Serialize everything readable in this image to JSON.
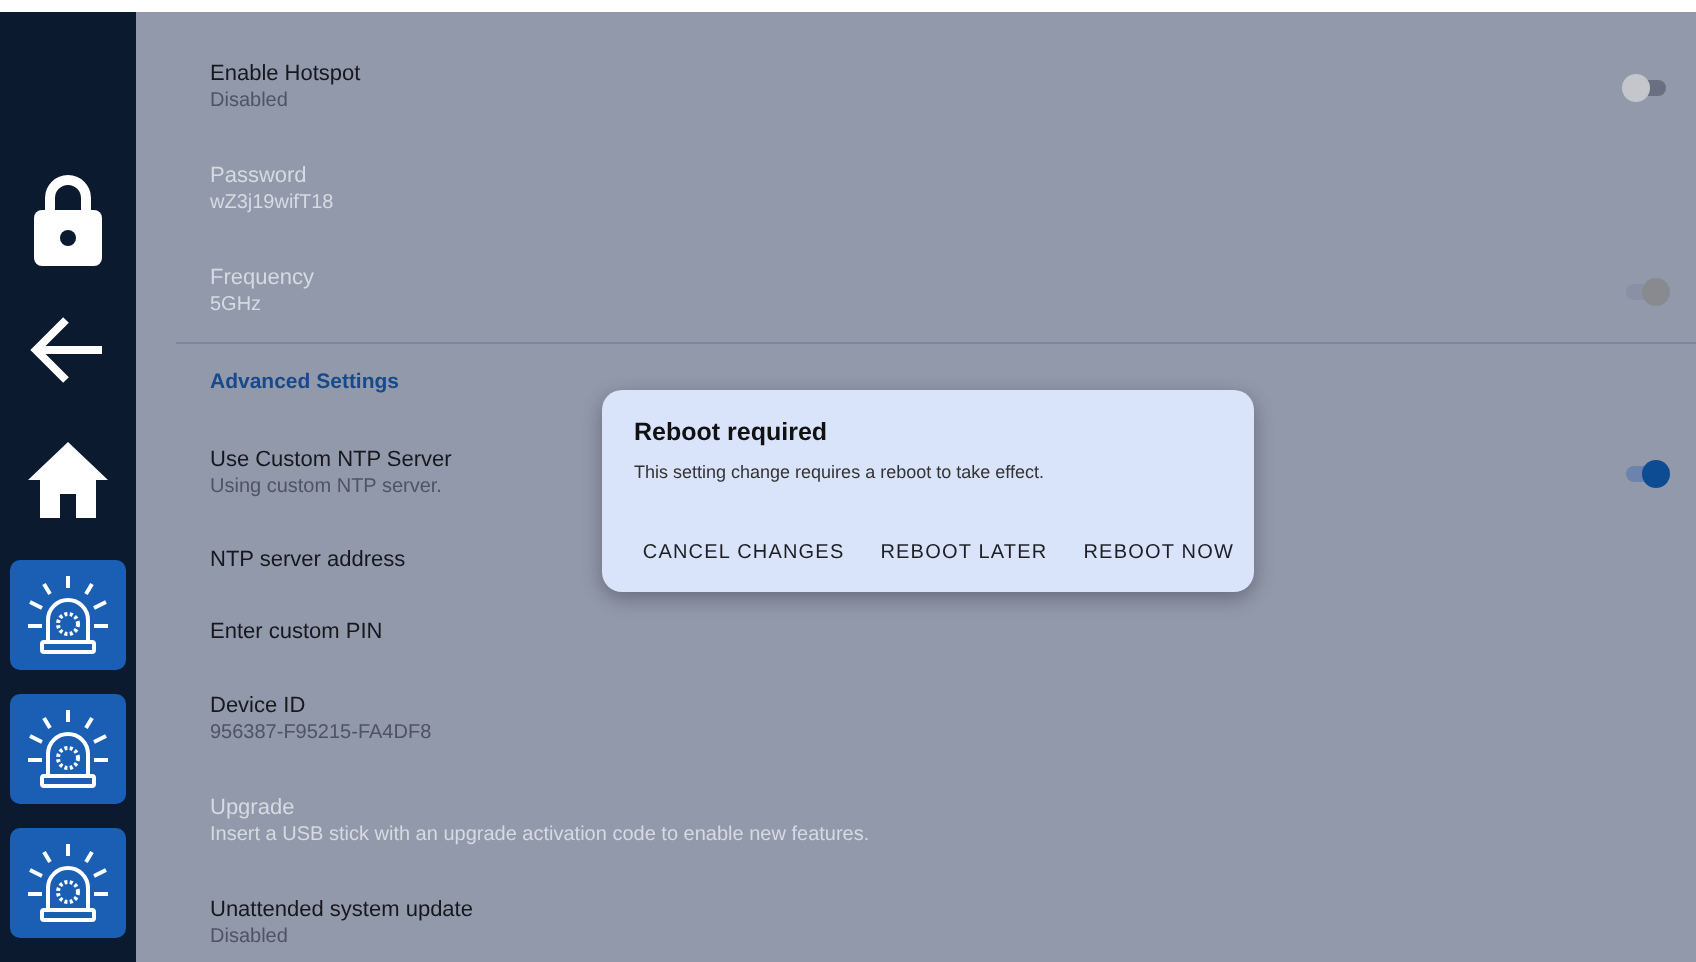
{
  "sidebar": {
    "buttons": [
      {
        "kind": "lock"
      },
      {
        "kind": "back"
      },
      {
        "kind": "home"
      },
      {
        "kind": "beacon"
      },
      {
        "kind": "beacon"
      },
      {
        "kind": "beacon"
      }
    ]
  },
  "settings": [
    {
      "kind": "setting",
      "title": "Enable Hotspot",
      "subtitle": "Disabled",
      "disabled": false,
      "switch": {
        "on": false
      }
    },
    {
      "kind": "setting",
      "title": "Password",
      "subtitle": "wZ3j19wifT18",
      "disabled": true
    },
    {
      "kind": "setting",
      "title": "Frequency",
      "subtitle": "5GHz",
      "disabled": true,
      "switch": {
        "on": true
      }
    },
    {
      "kind": "divider"
    },
    {
      "kind": "header",
      "title": "Advanced Settings"
    },
    {
      "kind": "setting",
      "title": "Use Custom NTP Server",
      "subtitle": "Using custom NTP server.",
      "disabled": false,
      "switch": {
        "on": true
      }
    },
    {
      "kind": "setting",
      "title": "NTP server address",
      "disabled": false
    },
    {
      "kind": "setting",
      "title": "Enter custom PIN",
      "disabled": false
    },
    {
      "kind": "setting",
      "title": "Device ID",
      "subtitle": "956387-F95215-FA4DF8",
      "disabled": false
    },
    {
      "kind": "setting",
      "title": "Upgrade",
      "subtitle": "Insert a USB stick with an upgrade activation code to enable new features.",
      "disabled": true
    },
    {
      "kind": "setting",
      "title": "Unattended system update",
      "subtitle": "Disabled",
      "disabled": false
    }
  ],
  "dialog": {
    "title": "Reboot required",
    "message": "This setting change requires a reboot to take effect.",
    "buttons": [
      "CANCEL CHANGES",
      "REBOOT LATER",
      "REBOOT NOW"
    ]
  }
}
